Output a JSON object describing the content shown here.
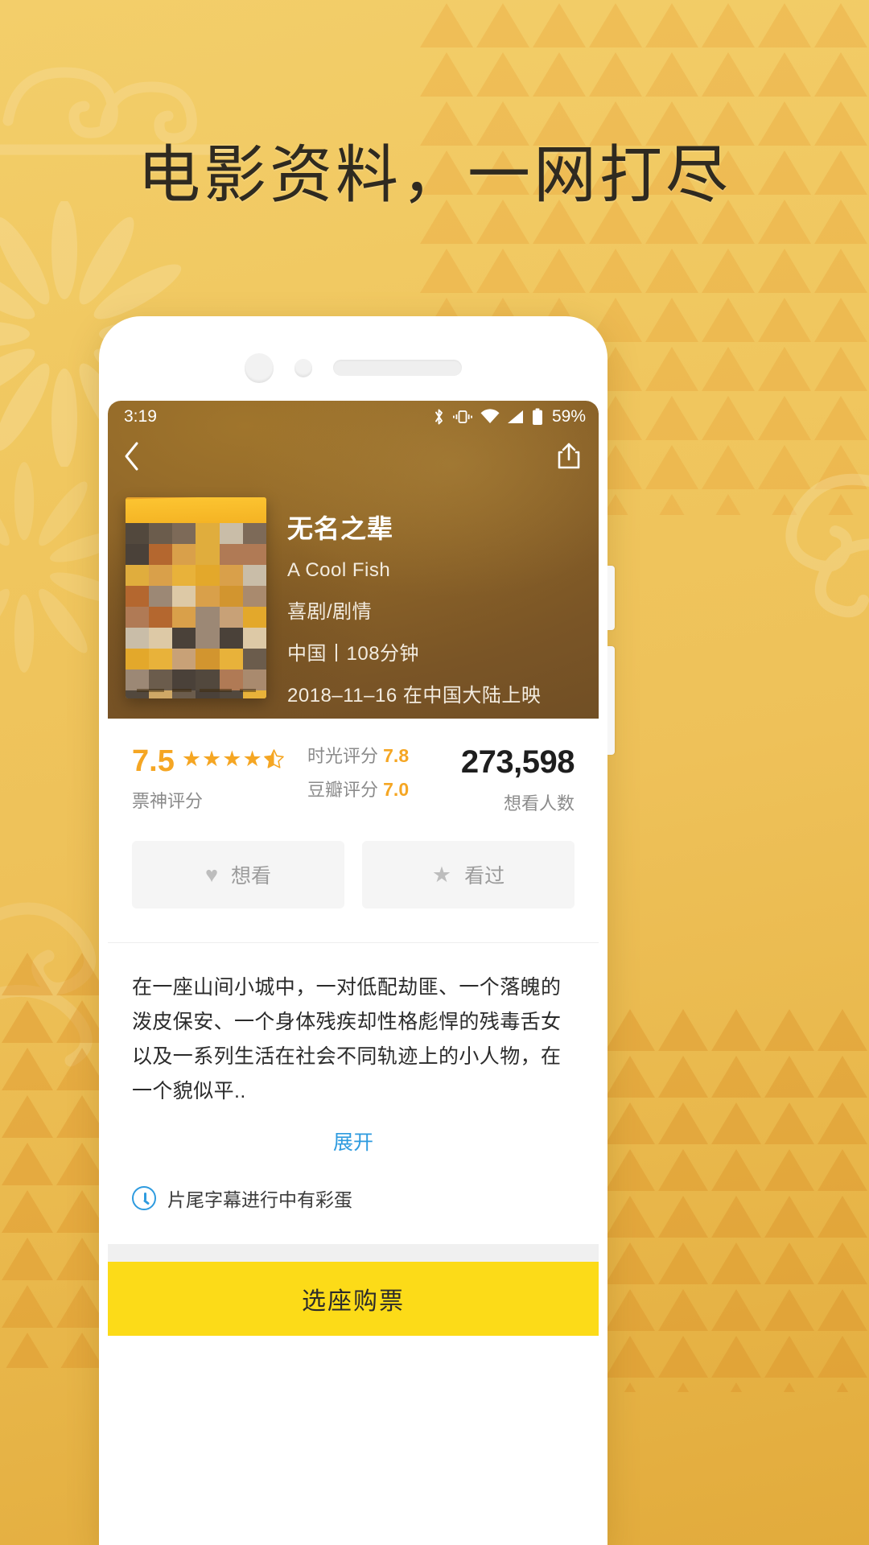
{
  "promo": {
    "headline": "电影资料，一网打尽",
    "bg_color": "#eec159",
    "accent_color": "#f5a623"
  },
  "phone": {
    "statusbar": {
      "time": "3:19",
      "battery_percent": "59%",
      "icons": [
        "bluetooth-icon",
        "vibrate-icon",
        "wifi-icon",
        "signal-icon",
        "battery-icon"
      ]
    },
    "nav": {
      "back_icon": "back-chevron-icon",
      "share_icon": "share-icon"
    },
    "movie": {
      "title": "无名之辈",
      "original_title": "A Cool Fish",
      "genre": "喜剧/剧情",
      "region_duration": "中国丨108分钟",
      "release": "2018–11–16 在中国大陆上映",
      "poster_alt": "movie-poster"
    },
    "ratings": {
      "main_score": "7.5",
      "main_label": "票神评分",
      "stars_filled": 4,
      "stars_half": true,
      "secondary": [
        {
          "label": "时光评分",
          "value": "7.8"
        },
        {
          "label": "豆瓣评分",
          "value": "7.0"
        }
      ],
      "want_count": "273,598",
      "want_label": "想看人数"
    },
    "actions": [
      {
        "icon": "heart-icon",
        "label": "想看"
      },
      {
        "icon": "star-icon",
        "label": "看过"
      }
    ],
    "synopsis": {
      "text": "在一座山间小城中，一对低配劫匪、一个落魄的泼皮保安、一个身体残疾却性格彪悍的残毒舌女以及一系列生活在社会不同轨迹上的小人物，在一个貌似平..",
      "expand_label": "展开"
    },
    "egg_note": "片尾字幕进行中有彩蛋",
    "buy_button": "选座购票"
  }
}
